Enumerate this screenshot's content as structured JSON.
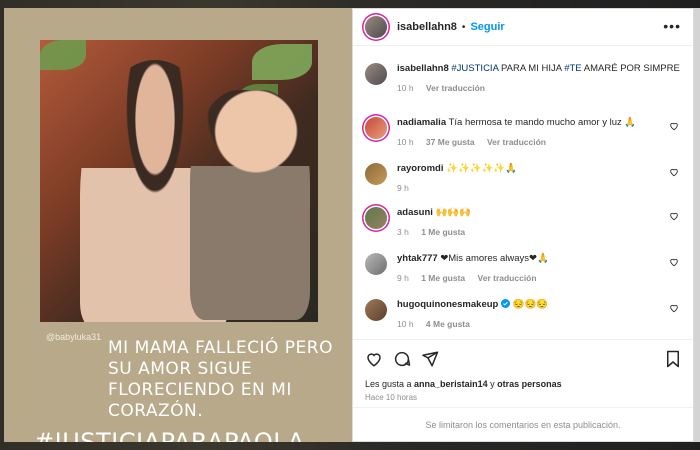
{
  "header": {
    "username": "isabellahn8",
    "dot": "•",
    "follow_label": "Seguir",
    "more_label": "•••"
  },
  "media": {
    "handle": "@babyluka31",
    "caption": "MI MAMA FALLECIÓ PERO SU AMOR SIGUE FLORECIENDO EN MI CORAZÓN.",
    "hashtag": "#JUSTICIAPARAPAOLA"
  },
  "post": {
    "username": "isabellahn8",
    "text_before": "",
    "tag1": "#JUSTICIA",
    "text_mid": " PARA MI HIJA ",
    "tag2": "#TE",
    "text_after": " AMARÉ POR SIMPRE",
    "time": "10 h",
    "translate_label": "Ver traducción"
  },
  "comments": [
    {
      "username": "nadiamalia",
      "text": "Tía hermosa te mando mucho amor y luz 🙏",
      "time": "10 h",
      "likes": "37 Me gusta",
      "translate": "Ver traducción"
    },
    {
      "username": "rayoromdi",
      "text": "✨✨✨✨✨🙏",
      "time": "9 h",
      "likes": "",
      "translate": ""
    },
    {
      "username": "adasuni",
      "text": "🙌🙌🙌",
      "time": "3 h",
      "likes": "1 Me gusta",
      "translate": ""
    },
    {
      "username": "yhtak777",
      "text": "❤Mis amores always❤🙏",
      "time": "9 h",
      "likes": "1 Me gusta",
      "translate": "Ver traducción"
    },
    {
      "username": "hugoquinonesmakeup",
      "text": "😔😔😔",
      "time": "10 h",
      "likes": "4 Me gusta",
      "translate": ""
    }
  ],
  "actions": {
    "likes_prefix": "Les gusta a ",
    "likes_user": "anna_beristain14",
    "likes_mid": " y ",
    "likes_others": "otras personas",
    "time_ago": "Hace 10 horas"
  },
  "footer": {
    "message": "Se limitaron los comentarios en esta publicación."
  },
  "colors": {
    "accent": "#0095f6",
    "verified": "#0095f6",
    "story_ring": "#d6249f"
  }
}
